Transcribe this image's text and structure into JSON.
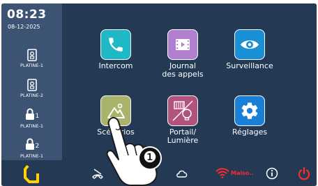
{
  "clock": {
    "time": "08:23",
    "date": "08-12-2025"
  },
  "sidebar": {
    "items": [
      {
        "label": "PLATINE-1",
        "icon": "door-icon",
        "sub": ""
      },
      {
        "label": "PLATINE-2",
        "icon": "door-icon",
        "sub": ""
      },
      {
        "label": "PLATINE-1",
        "icon": "lock-icon",
        "sub": "1"
      },
      {
        "label": "PLATINE-1",
        "icon": "lock-icon",
        "sub": "2"
      }
    ]
  },
  "tiles": [
    {
      "label": "Intercom",
      "icon": "phone-icon",
      "color": "#1fb8c6"
    },
    {
      "label": "Journal\ndes appels",
      "icon": "film-icon",
      "color": "#b07fcf"
    },
    {
      "label": "Surveillance",
      "icon": "eye-icon",
      "color": "#1a8fd6"
    },
    {
      "label": "Scénarios",
      "icon": "scenario-icon",
      "color": "#a9b36b"
    },
    {
      "label": "Portail/\nLumière",
      "icon": "gate-light-icon",
      "color": "#b0537e"
    },
    {
      "label": "Réglages",
      "icon": "gear-icon",
      "color": "#1a7fd6"
    }
  ],
  "bottom_bar": {
    "status_text": "Maiso..",
    "colors": {
      "wifi": "#ff2a2a",
      "power": "#ff2a2a",
      "logo": "#ffd200"
    }
  },
  "annotation": {
    "marker": "❶"
  }
}
